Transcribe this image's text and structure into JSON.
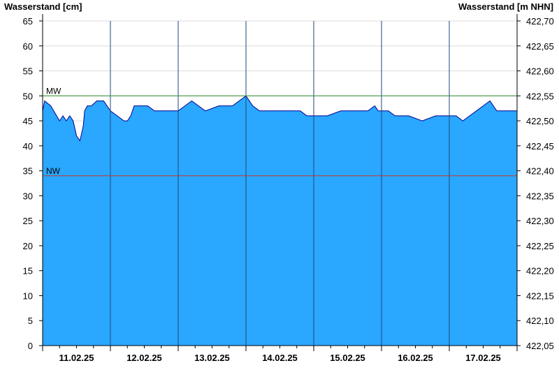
{
  "chart_data": {
    "type": "area",
    "ylabel_left": "Wasserstand [cm]",
    "ylabel_right": "Wasserstand [m NHN]",
    "ylim_left": [
      0,
      65
    ],
    "ylim_right": [
      422.05,
      422.7
    ],
    "left_ticks": [
      0,
      5,
      10,
      15,
      20,
      25,
      30,
      35,
      40,
      45,
      50,
      55,
      60,
      65
    ],
    "right_ticks": [
      "422,05",
      "422,10",
      "422,15",
      "422,20",
      "422,25",
      "422,30",
      "422,35",
      "422,40",
      "422,45",
      "422,50",
      "422,55",
      "422,60",
      "422,65",
      "422,70"
    ],
    "x_range_days": [
      0,
      7
    ],
    "day_labels": [
      "11.02.25",
      "12.02.25",
      "13.02.25",
      "14.02.25",
      "15.02.25",
      "16.02.25",
      "17.02.25"
    ],
    "reference_lines": [
      {
        "label": "MW",
        "value": 50,
        "color": "#2e8b2e"
      },
      {
        "label": "NW",
        "value": 34,
        "color": "#c0392b"
      }
    ],
    "fill_color": "#2aa7ff",
    "line_color": "#00008b",
    "series": [
      {
        "x": [
          0.0,
          0.03,
          0.12,
          0.25,
          0.3,
          0.35,
          0.4,
          0.45,
          0.5,
          0.55,
          0.6,
          0.62,
          0.66,
          0.72,
          0.8,
          0.9,
          1.0,
          1.1,
          1.2,
          1.25,
          1.3,
          1.35,
          1.4,
          1.45,
          1.5,
          1.55,
          1.65,
          1.8,
          2.0,
          2.1,
          2.2,
          2.4,
          2.6,
          2.7,
          2.8,
          3.0,
          3.1,
          3.2,
          3.3,
          3.5,
          3.7,
          3.8,
          3.9,
          4.0,
          4.1,
          4.2,
          4.4,
          4.6,
          4.8,
          4.9,
          4.95,
          5.0,
          5.1,
          5.2,
          5.4,
          5.6,
          5.8,
          6.0,
          6.1,
          6.2,
          6.3,
          6.4,
          6.5,
          6.6,
          6.7,
          6.8,
          6.9,
          7.0
        ],
        "values": [
          47,
          49,
          48,
          45,
          46,
          45,
          46,
          45,
          42,
          41,
          44,
          47,
          48,
          48,
          49,
          49,
          47,
          46,
          45,
          45,
          46,
          48,
          48,
          48,
          48,
          48,
          47,
          47,
          47,
          48,
          49,
          47,
          48,
          48,
          48,
          50,
          48,
          47,
          47,
          47,
          47,
          47,
          46,
          46,
          46,
          46,
          47,
          47,
          47,
          48,
          47,
          47,
          47,
          46,
          46,
          45,
          46,
          46,
          46,
          45,
          46,
          47,
          48,
          49,
          47,
          47,
          47,
          47
        ]
      }
    ]
  }
}
